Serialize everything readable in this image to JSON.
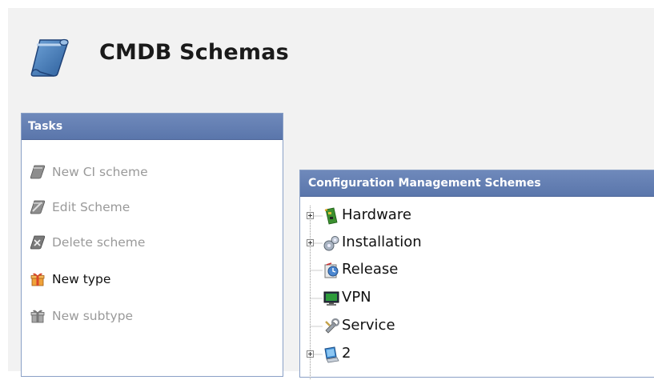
{
  "page": {
    "title": "CMDB Schemas",
    "title_icon": "scroll-icon"
  },
  "tasks": {
    "header": "Tasks",
    "items": [
      {
        "label": "New CI scheme",
        "icon": "new-scheme-icon",
        "enabled": false
      },
      {
        "label": "Edit Scheme",
        "icon": "edit-scheme-icon",
        "enabled": false
      },
      {
        "label": "Delete scheme",
        "icon": "delete-scheme-icon",
        "enabled": false
      },
      {
        "label": "New type",
        "icon": "gift-box-icon",
        "enabled": true
      },
      {
        "label": "New subtype",
        "icon": "gift-box-icon",
        "enabled": false
      }
    ]
  },
  "schemes": {
    "header": "Configuration Management Schemes",
    "nodes": [
      {
        "label": "Hardware",
        "icon": "circuit-board-icon",
        "expandable": true
      },
      {
        "label": "Installation",
        "icon": "gears-icon",
        "expandable": true
      },
      {
        "label": "Release",
        "icon": "release-icon",
        "expandable": false
      },
      {
        "label": "VPN",
        "icon": "monitor-icon",
        "expandable": false
      },
      {
        "label": "Service",
        "icon": "service-icon",
        "expandable": false
      },
      {
        "label": "2",
        "icon": "computer-icon",
        "expandable": true
      }
    ]
  },
  "colors": {
    "panel_header": "#5f7cb0",
    "disabled_text": "#9a9a9a",
    "page_background": "#f2f2f2"
  }
}
